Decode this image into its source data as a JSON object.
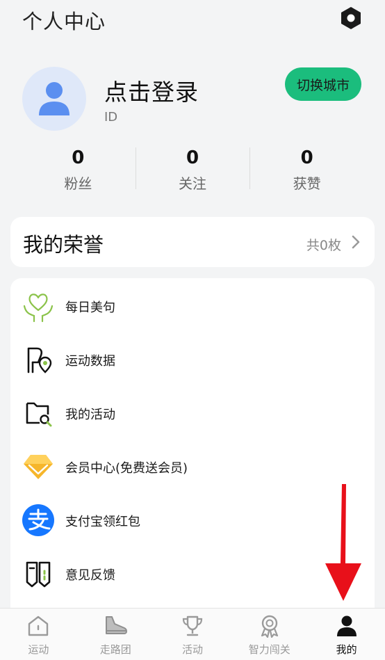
{
  "header": {
    "title": "个人中心",
    "settings_icon": "settings-hexagon-icon"
  },
  "profile": {
    "avatar_icon": "person-icon",
    "login_label": "点击登录",
    "id_label": "ID",
    "switch_city_label": "切换城市",
    "switch_city_color": "#1bbd7d"
  },
  "stats": [
    {
      "count": "0",
      "label": "粉丝"
    },
    {
      "count": "0",
      "label": "关注"
    },
    {
      "count": "0",
      "label": "获赞"
    }
  ],
  "honor": {
    "title": "我的荣誉",
    "count_label": "共0枚",
    "chevron_icon": "chevron-right-icon"
  },
  "menu": [
    {
      "label": "每日美句",
      "icon": "heart-hands-icon"
    },
    {
      "label": "运动数据",
      "icon": "sport-data-icon"
    },
    {
      "label": "我的活动",
      "icon": "activity-search-icon"
    },
    {
      "label": "会员中心(免费送会员)",
      "icon": "diamond-icon"
    },
    {
      "label": "支付宝领红包",
      "icon": "alipay-icon"
    },
    {
      "label": "意见反馈",
      "icon": "feedback-icon"
    }
  ],
  "tabs": [
    {
      "label": "运动",
      "icon": "home-icon",
      "active": false
    },
    {
      "label": "走路团",
      "icon": "shoe-icon",
      "active": false
    },
    {
      "label": "活动",
      "icon": "trophy-icon",
      "active": false
    },
    {
      "label": "智力闯关",
      "icon": "medal-icon",
      "active": false
    },
    {
      "label": "我的",
      "icon": "person-icon",
      "active": true
    }
  ],
  "annotation": {
    "arrow_color": "#e8101a"
  }
}
